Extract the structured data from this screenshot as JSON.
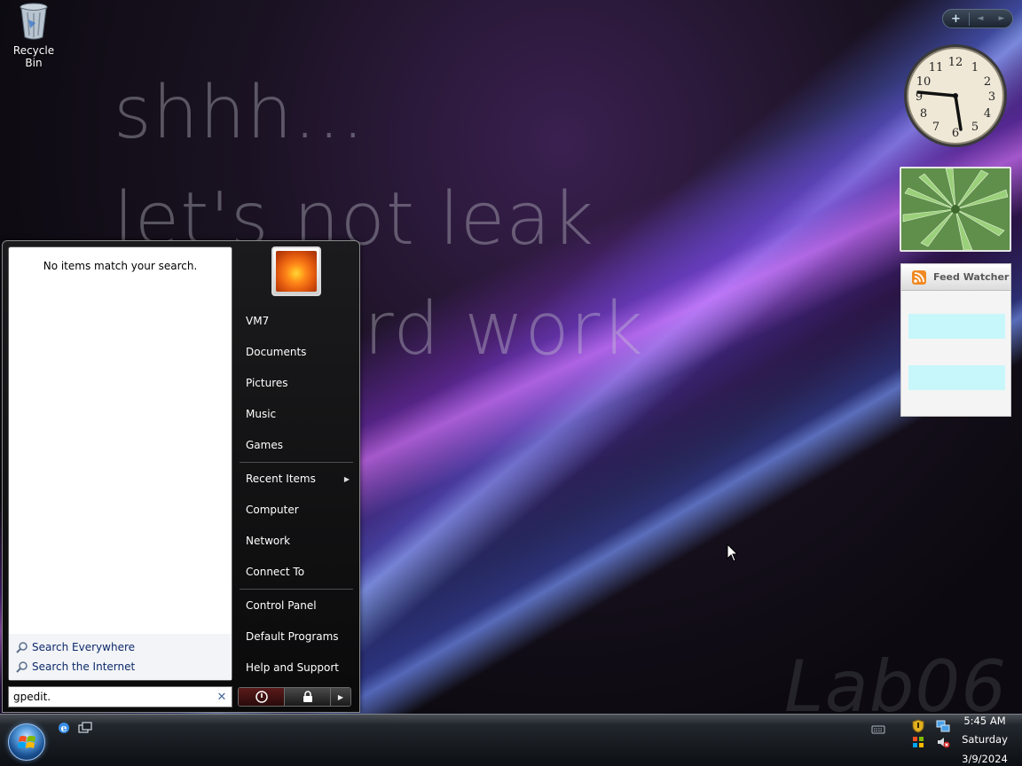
{
  "desktop": {
    "wallpaper_text": {
      "line1": "shhh...",
      "line2": "let's not leak",
      "line3": "rd work",
      "watermark": "Lab06"
    },
    "icons": [
      {
        "label": "Recycle Bin",
        "icon": "recycle-bin-icon"
      }
    ]
  },
  "sidebar": {
    "controls": {
      "add": "+",
      "prev": "◄",
      "next": "►"
    },
    "clock": {
      "numbers": [
        "12",
        "1",
        "2",
        "3",
        "4",
        "5",
        "6",
        "7",
        "8",
        "9",
        "10",
        "11"
      ]
    },
    "feed_watcher": {
      "title": "Feed Watcher"
    }
  },
  "start_menu": {
    "no_results": "No items match your search.",
    "search_links": [
      {
        "label": "Search Everywhere"
      },
      {
        "label": "Search the Internet"
      }
    ],
    "search": {
      "value": "gpedit."
    },
    "right_items": [
      {
        "label": "VM7"
      },
      {
        "label": "Documents"
      },
      {
        "label": "Pictures"
      },
      {
        "label": "Music"
      },
      {
        "label": "Games"
      },
      {
        "label": "Recent Items"
      },
      {
        "label": "Computer"
      },
      {
        "label": "Network"
      },
      {
        "label": "Connect To"
      },
      {
        "label": "Control Panel"
      },
      {
        "label": "Default Programs"
      },
      {
        "label": "Help and Support"
      }
    ]
  },
  "taskbar": {
    "clock": {
      "time": "5:45 AM",
      "day": "Saturday",
      "date": "3/9/2024"
    }
  },
  "colors": {
    "accent": "#5ba0e0",
    "feed_row": "#c8f7fb",
    "link": "#0e2a6b"
  }
}
